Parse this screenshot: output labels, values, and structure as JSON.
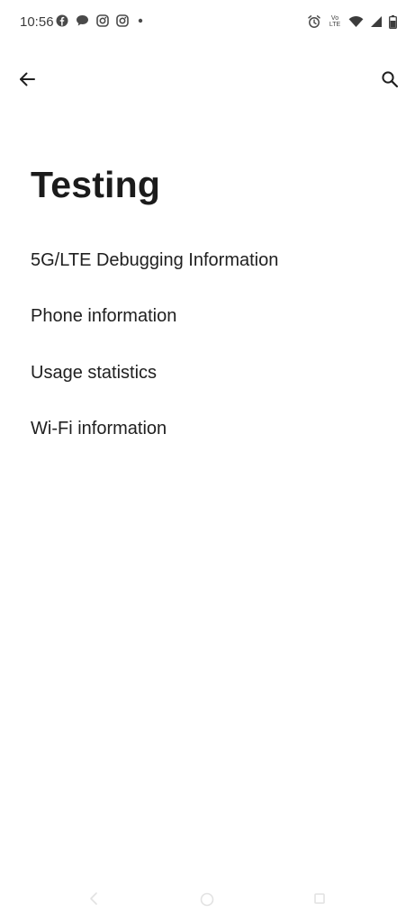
{
  "status_bar": {
    "time": "10:56",
    "left_icons": [
      "facebook-icon",
      "chat-bubble-icon",
      "instagram-icon",
      "instagram-icon",
      "dot-icon"
    ],
    "volte_label_top": "Vo",
    "volte_label_bottom": "LTE",
    "right_icons": [
      "alarm-icon",
      "volte-icon",
      "wifi-icon",
      "signal-icon",
      "battery-icon"
    ]
  },
  "app_bar": {
    "back_icon": "arrow-back-icon",
    "search_icon": "search-icon"
  },
  "page": {
    "title": "Testing"
  },
  "list": {
    "items": [
      {
        "label": "5G/LTE Debugging Information"
      },
      {
        "label": "Phone information"
      },
      {
        "label": "Usage statistics"
      },
      {
        "label": "Wi-Fi information"
      }
    ]
  },
  "nav_bar": {
    "icons": [
      "nav-back-icon",
      "nav-home-icon",
      "nav-recents-icon"
    ]
  }
}
